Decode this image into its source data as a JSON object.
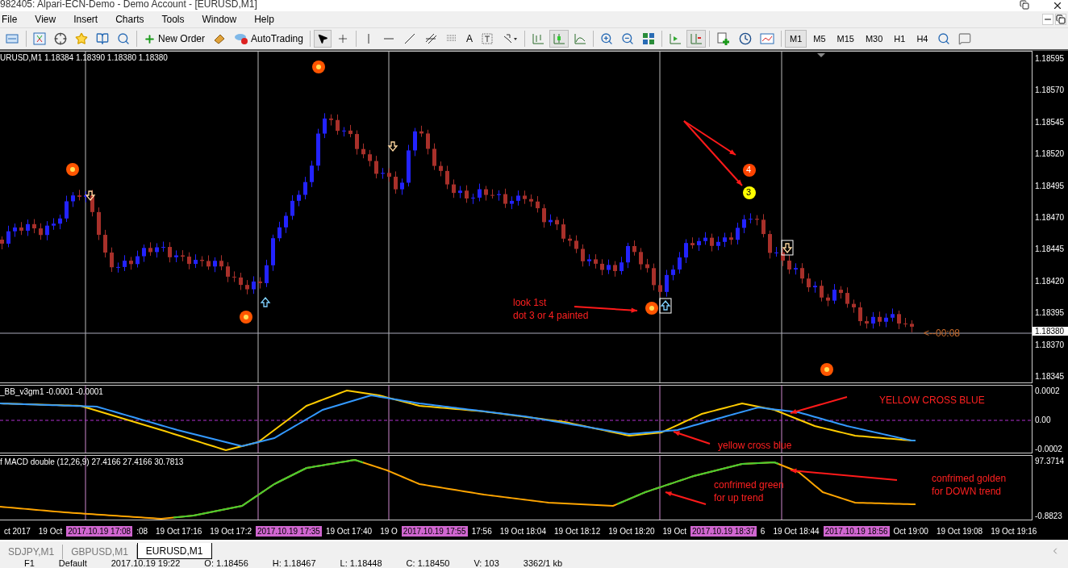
{
  "window": {
    "title": "982405: Alpari-ECN-Demo - Demo Account - [EURUSD,M1]"
  },
  "menu": [
    "File",
    "View",
    "Insert",
    "Charts",
    "Tools",
    "Window",
    "Help"
  ],
  "toolbar": {
    "new_order": "New Order",
    "auto_trading": "AutoTrading",
    "text_tool": "A",
    "timeframes": [
      {
        "label": "M1",
        "selected": true
      },
      {
        "label": "M5",
        "selected": false
      },
      {
        "label": "M15",
        "selected": false
      },
      {
        "label": "M30",
        "selected": false
      },
      {
        "label": "H1",
        "selected": false
      },
      {
        "label": "H4",
        "selected": false
      }
    ]
  },
  "main_pane": {
    "header": "URUSD,M1 1.18384 1.18390 1.18380 1.18380",
    "price_labels": [
      "1.18595",
      "1.18570",
      "1.18545",
      "1.18520",
      "1.18495",
      "1.18470",
      "1.18445",
      "1.18420",
      "1.18395",
      "1.18370",
      "1.18345"
    ],
    "current_price": "1.18380",
    "markers": [
      {
        "label": "4",
        "color": "#ff4400"
      },
      {
        "label": "3",
        "color": "#ffff00"
      }
    ],
    "annotations": [
      {
        "text": "look 1st\ndot 3 or 4 painted"
      },
      {
        "text": "<--00:08"
      }
    ]
  },
  "indicator_pane": {
    "header": "_BB_v3gm1 -0.0001 -0.0001",
    "scale": [
      "0.0002",
      "0.00",
      "-0.0002"
    ],
    "annotations": [
      {
        "text": "YELLOW CROSS BLUE"
      },
      {
        "text": "yellow cross blue"
      }
    ]
  },
  "macd_pane": {
    "header": "f MACD double (12,26,9) 27.4166 27.4166 30.7813",
    "scale": [
      "97.3714",
      "-0.8823"
    ],
    "annotations": [
      {
        "text": "confrimed green\nfor up trend"
      },
      {
        "text": "confrimed golden\nfor DOWN trend"
      }
    ]
  },
  "time_axis": [
    {
      "text": "ct 2017",
      "kind": "tick"
    },
    {
      "text": "19 Oct",
      "kind": "tick"
    },
    {
      "text": "2017.10.19 17:08",
      "kind": "marker"
    },
    {
      "text": ":08",
      "kind": "tick"
    },
    {
      "text": "19 Oct 17:16",
      "kind": "tick"
    },
    {
      "text": "19 Oct 17:2",
      "kind": "tick"
    },
    {
      "text": "2017.10.19 17:35",
      "kind": "marker"
    },
    {
      "text": "19 Oct 17:40",
      "kind": "tick"
    },
    {
      "text": "19 O",
      "kind": "tick"
    },
    {
      "text": "2017.10.19 17:55",
      "kind": "marker"
    },
    {
      "text": "17:56",
      "kind": "tick"
    },
    {
      "text": "19 Oct 18:04",
      "kind": "tick"
    },
    {
      "text": "19 Oct 18:12",
      "kind": "tick"
    },
    {
      "text": "19 Oct 18:20",
      "kind": "tick"
    },
    {
      "text": "19 Oct",
      "kind": "tick"
    },
    {
      "text": "2017.10.19 18:37",
      "kind": "marker"
    },
    {
      "text": "6",
      "kind": "tick"
    },
    {
      "text": "19 Oct 18:44",
      "kind": "tick"
    },
    {
      "text": "2017.10.19 18:56",
      "kind": "marker"
    },
    {
      "text": "Oct 19:00",
      "kind": "tick"
    },
    {
      "text": "19 Oct 19:08",
      "kind": "tick"
    },
    {
      "text": "19 Oct 19:16",
      "kind": "tick"
    }
  ],
  "tabs": [
    {
      "label": "SDJPY,M1",
      "selected": false
    },
    {
      "label": "GBPUSD,M1",
      "selected": false
    },
    {
      "label": "EURUSD,M1",
      "selected": true
    }
  ],
  "status_bar": [
    "F1",
    "Default",
    "2017.10.19 19:22",
    "O: 1.18456",
    "H: 1.18467",
    "L: 1.18448",
    "C: 1.18450",
    "V: 103",
    "3362/1 kb"
  ]
}
